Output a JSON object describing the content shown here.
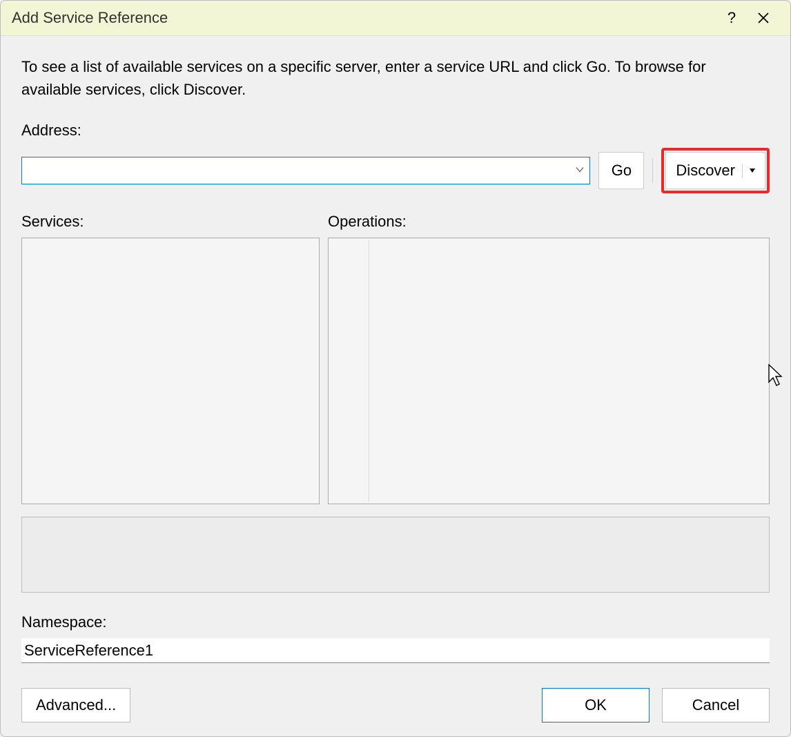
{
  "dialog": {
    "title": "Add Service Reference",
    "instructions": "To see a list of available services on a specific server, enter a service URL and click Go. To browse for available services, click Discover.",
    "address_label": "Address:",
    "address_value": "",
    "go_label": "Go",
    "discover_label": "Discover",
    "services_label": "Services:",
    "operations_label": "Operations:",
    "namespace_label": "Namespace:",
    "namespace_value": "ServiceReference1",
    "advanced_label": "Advanced...",
    "ok_label": "OK",
    "cancel_label": "Cancel"
  }
}
